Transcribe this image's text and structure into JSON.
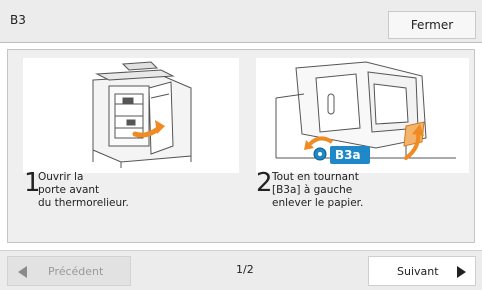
{
  "header": {
    "title": "B3",
    "close_label": "Fermer"
  },
  "steps": [
    {
      "number": "1",
      "text": "Ouvrir la\nporte avant\ndu thermorelieur."
    },
    {
      "number": "2",
      "text": "Tout en tournant\n[B3a] à gauche\nenlever le papier.",
      "illustration_label": "B3a"
    }
  ],
  "footer": {
    "prev_label": "Précédent",
    "page_indicator": "1/2",
    "next_label": "Suivant"
  },
  "colors": {
    "accent_blue": "#1e88c8",
    "highlight_orange": "#f08a22",
    "panel_bg": "#efefef"
  }
}
